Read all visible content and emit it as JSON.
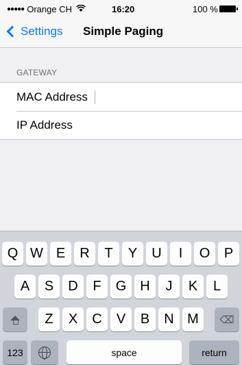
{
  "status_bar": {
    "carrier": "Orange CH",
    "signal_dots": "●●●●●",
    "wifi_icon": "wifi-icon",
    "time": "16:20",
    "battery_percent": "100 %",
    "battery_level": 1.0
  },
  "nav": {
    "back_label": "Settings",
    "title": "Simple Paging"
  },
  "section": {
    "header": "GATEWAY",
    "rows": [
      {
        "label": "MAC Address",
        "focused": true
      },
      {
        "label": "IP Address",
        "focused": false
      }
    ]
  },
  "keyboard": {
    "row1": [
      "Q",
      "W",
      "E",
      "R",
      "T",
      "Y",
      "U",
      "I",
      "O",
      "P"
    ],
    "row2": [
      "A",
      "S",
      "D",
      "F",
      "G",
      "H",
      "J",
      "K",
      "L"
    ],
    "row3": [
      "Z",
      "X",
      "C",
      "V",
      "B",
      "N",
      "M"
    ],
    "shift_icon": "shift-icon",
    "backspace_icon": "backspace-icon",
    "globe_icon": "globe-icon",
    "numbers_label": "123",
    "space_label": "space",
    "return_label": "return",
    "backspace_glyph": "⌫"
  },
  "colors": {
    "accent": "#007aff",
    "background": "#efeff4",
    "keyboard_bg": "#d1d5db"
  }
}
